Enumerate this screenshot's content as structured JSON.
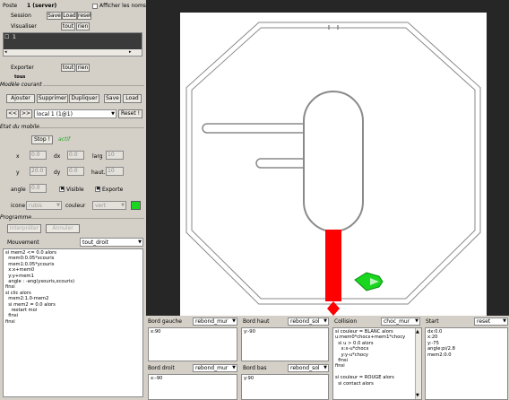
{
  "header": {
    "poste_label": "Poste",
    "poste_value": "1 (server)",
    "show_names_label": "Afficher les noms"
  },
  "session": {
    "label": "Session",
    "save": "Save",
    "load": "Load",
    "reset": "reset"
  },
  "visualiser": {
    "label": "Visualiser",
    "tout": "tout",
    "rien": "rien",
    "list_item": "1"
  },
  "exporter": {
    "label": "Exporter",
    "tout": "tout",
    "rien": "rien",
    "value": "tous"
  },
  "modele": {
    "section": "Modèle courant",
    "add": "Ajouter",
    "delete": "Supprimer",
    "duplicate": "Dupliquer",
    "save": "Save",
    "load": "Load",
    "prev": "<<",
    "next": ">>",
    "current": "local 1 (1@1)",
    "reset": "Reset !"
  },
  "etat": {
    "section": "Etat du mobile",
    "stop": "Stop !",
    "status": "actif",
    "x_label": "x",
    "x": "0.0",
    "dx_label": "dx",
    "dx": "0.0",
    "larg_label": "larg",
    "larg": "10",
    "y_label": "y",
    "y": "20.0",
    "dy_label": "dy",
    "dy": "0.0",
    "haut_label": "haut.",
    "haut": "10",
    "angle_label": "angle",
    "angle": "0.0",
    "visible_label": "Visible",
    "exporte_label": "Exporte",
    "icone_label": "icone",
    "icone_value": "rubis",
    "couleur_label": "couleur",
    "couleur_value": "vert",
    "color_swatch": "#19d61e"
  },
  "programme": {
    "section": "Programme",
    "btn1": "Interpréter",
    "btn2": "Annuler"
  },
  "mouvement": {
    "label": "Mouvement",
    "mode": "tout_droit",
    "code": "si mem2 <= 0.0 alors\n  mem0:0.05*xcouris\n  mem1:0.05*ycouris\n  x:x+mem0\n  y:y+mem1\n  angle : -ang(ysouris,xcouris)\nfinsi\nsi clic alors\n  mem2:1.0-mem2\n  si mem2 = 0.0 alors\n    restart moi\n  finsi\nfinsi"
  },
  "bords": {
    "gauche": {
      "label": "Bord gauche",
      "mode": "rebond_mur",
      "code": "x:90"
    },
    "haut": {
      "label": "Bord haut",
      "mode": "rebond_sol",
      "code": "y:-90"
    },
    "droit": {
      "label": "Bord droit",
      "mode": "rebond_mur",
      "code": "x:-90"
    },
    "bas": {
      "label": "Bord bas",
      "mode": "rebond_sol",
      "code": "y:90"
    }
  },
  "collision": {
    "label": "Collision",
    "mode": "choc_mur",
    "code": "si couleur = BLANC alors\nu:mem0*chocx+mem1*chocy\n  si u > 0.0 alors\n    x:x-u*chocx\n    y:y-u*chocy\n  finsi\nfinsi\n\nsi couleur = ROUGE alors\n  si contact alors"
  },
  "start": {
    "label": "Start",
    "mode": "reset",
    "code": "dx:0.0\nx:20\ny:-75\nangle:pi/2.8\nmem2:0.0"
  },
  "colors": {
    "wall": "#ffffff",
    "outline": "#8a8a8a",
    "red": "#ff0000",
    "mobile": "#19d61e",
    "bg": "#262626"
  }
}
